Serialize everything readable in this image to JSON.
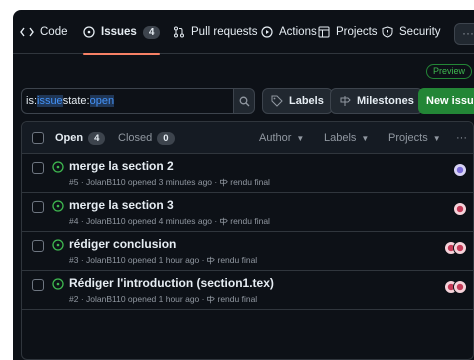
{
  "nav": {
    "tabs": [
      {
        "label": "Code",
        "icon": "code-icon"
      },
      {
        "label": "Issues",
        "icon": "issue-opened-icon",
        "count": "4"
      },
      {
        "label": "Pull requests",
        "icon": "git-pull-request-icon"
      },
      {
        "label": "Actions",
        "icon": "play-icon"
      },
      {
        "label": "Projects",
        "icon": "table-icon"
      },
      {
        "label": "Security",
        "icon": "shield-icon"
      }
    ],
    "more": "···"
  },
  "preview_badge": "Preview",
  "search": {
    "key1": "is:",
    "val1": "issue",
    "key2": " state:",
    "val2": "open"
  },
  "buttons": {
    "labels": "Labels",
    "milestones": "Milestones",
    "new_issue": "New issue"
  },
  "list": {
    "open_label": "Open",
    "open_count": "4",
    "closed_label": "Closed",
    "closed_count": "0",
    "filters": [
      "Author",
      "Labels",
      "Projects"
    ],
    "more": "···",
    "issues": [
      {
        "title": "merge la section 2",
        "meta": "#5 · JolanB110 opened 3 minutes ago ·",
        "milestone": "rendu final"
      },
      {
        "title": "merge la section 3",
        "meta": "#4 · JolanB110 opened 4 minutes ago ·",
        "milestone": "rendu final"
      },
      {
        "title": "rédiger conclusion",
        "meta": "#3 · JolanB110 opened 1 hour ago ·",
        "milestone": "rendu final"
      },
      {
        "title": "Rédiger l'introduction (section1.tex)",
        "meta": "#2 · JolanB110 opened 1 hour ago ·",
        "milestone": "rendu final"
      }
    ]
  },
  "colors": {
    "bg": "#0d1117",
    "accent_tab": "#f78166",
    "open_green": "#3fb950",
    "button_green": "#238636",
    "link_blue": "#4493f8"
  }
}
